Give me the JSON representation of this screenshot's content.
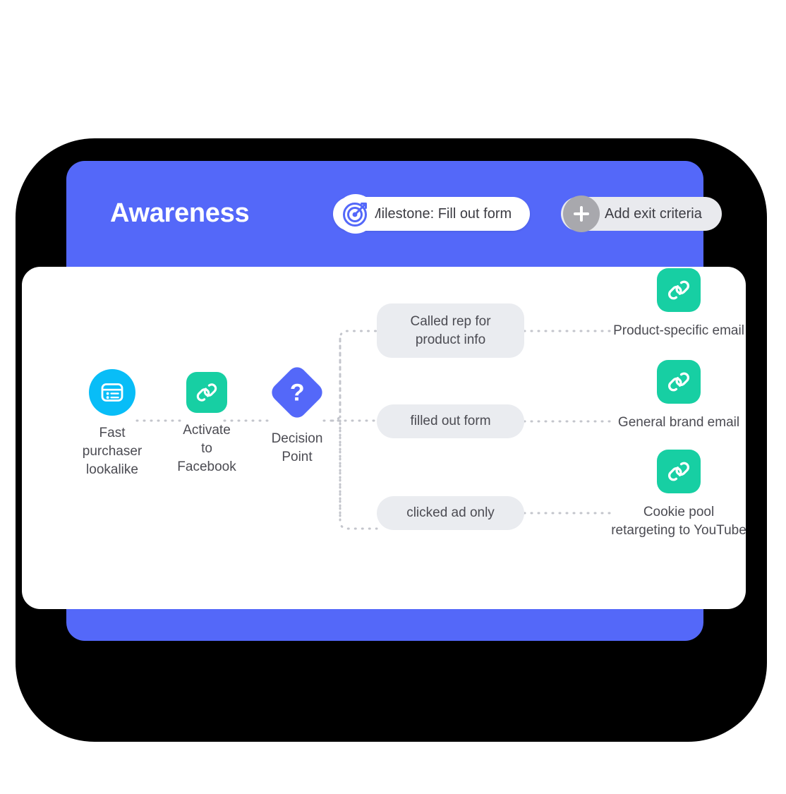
{
  "stage": {
    "title": "Awareness",
    "milestone": {
      "label": "Milestone: Fill out form",
      "icon": "target-bullseye-icon"
    },
    "exit_criteria": {
      "label": "Add exit criteria",
      "icon": "plus-icon"
    },
    "panel_color": "#5468f9"
  },
  "flow": {
    "source_nodes": [
      {
        "id": "fast-purchaser-lookalike",
        "caption": "Fast\npurchaser\nlookalike",
        "icon": "audience-list-icon",
        "icon_color": "#08bdf7",
        "icon_shape": "circle"
      },
      {
        "id": "activate-to-facebook",
        "caption": "Activate\nto\nFacebook",
        "icon": "link-chain-icon",
        "icon_color": "#17cfa3",
        "icon_shape": "rounded-square"
      },
      {
        "id": "decision-point",
        "caption": "Decision\nPoint",
        "icon": "question-mark-icon",
        "icon_color": "#5468f9",
        "icon_shape": "diamond",
        "glyph": "?"
      }
    ],
    "branches": [
      {
        "id": "called-rep",
        "condition": "Called rep for\nproduct info",
        "output_caption": "Product-specific email",
        "output_icon": "link-chain-icon",
        "output_color": "#17cfa3"
      },
      {
        "id": "filled-form",
        "condition": "filled out form",
        "output_caption": "General brand email",
        "output_icon": "link-chain-icon",
        "output_color": "#17cfa3"
      },
      {
        "id": "clicked-ad",
        "condition": "clicked ad only",
        "output_caption": "Cookie pool\nretargeting to YouTube",
        "output_icon": "link-chain-icon",
        "output_color": "#17cfa3"
      }
    ],
    "connector_style": "dotted",
    "connector_color": "#c3c5cc",
    "pill_color": "#eaecf0"
  }
}
